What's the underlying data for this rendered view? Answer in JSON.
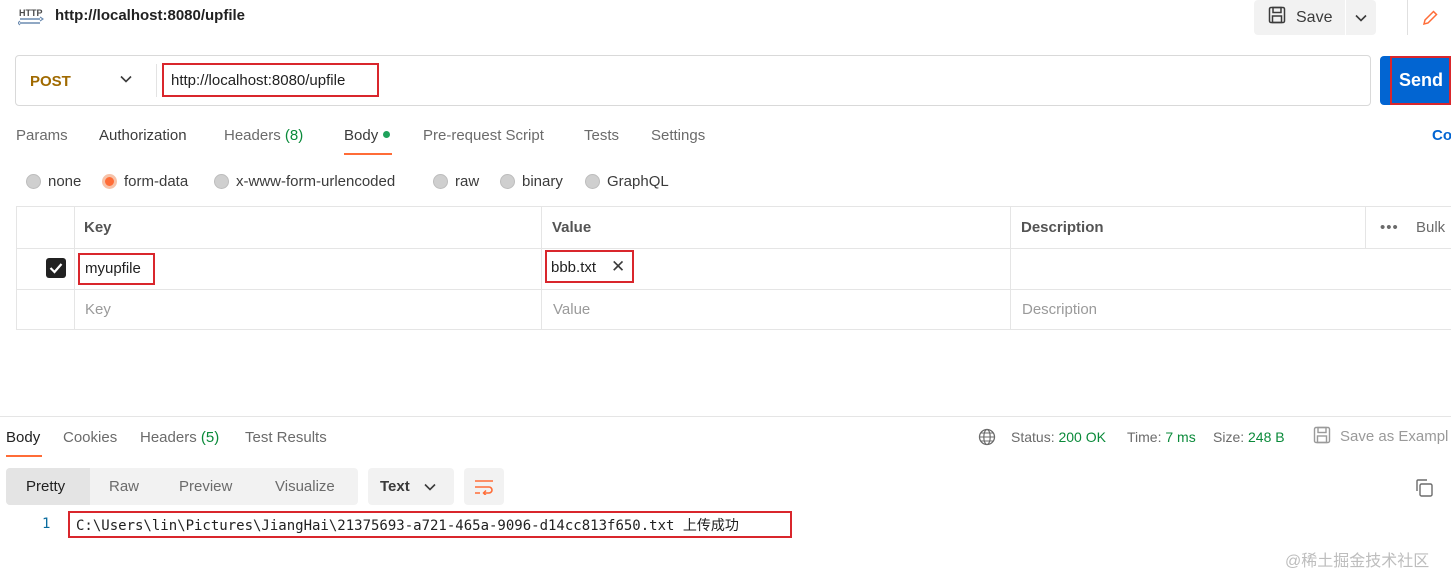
{
  "title_bar": {
    "http_icon_label": "HTTP",
    "request_title": "http://localhost:8080/upfile",
    "save_label": "Save"
  },
  "request": {
    "method": "POST",
    "url": "http://localhost:8080/upfile",
    "send_label": "Send",
    "tabs": [
      {
        "label": "Params"
      },
      {
        "label": "Authorization"
      },
      {
        "label": "Headers",
        "count": "(8)"
      },
      {
        "label": "Body"
      },
      {
        "label": "Pre-request Script"
      },
      {
        "label": "Tests"
      },
      {
        "label": "Settings"
      }
    ],
    "cookies_label": "Co",
    "body_types": [
      "none",
      "form-data",
      "x-www-form-urlencoded",
      "raw",
      "binary",
      "GraphQL"
    ],
    "selected_body_type": "form-data"
  },
  "form_table": {
    "headers": {
      "key": "Key",
      "value": "Value",
      "description": "Description",
      "bulk": "Bulk"
    },
    "rows": [
      {
        "checked": true,
        "key": "myupfile",
        "value": "bbb.txt",
        "description": ""
      }
    ],
    "placeholders": {
      "key": "Key",
      "value": "Value",
      "description": "Description"
    }
  },
  "response": {
    "tabs": [
      {
        "label": "Body"
      },
      {
        "label": "Cookies"
      },
      {
        "label": "Headers",
        "count": "(5)"
      },
      {
        "label": "Test Results"
      }
    ],
    "status_label": "Status:",
    "status_value": "200 OK",
    "time_label": "Time:",
    "time_value": "7 ms",
    "size_label": "Size:",
    "size_value": "248 B",
    "save_example_label": "Save as Exampl",
    "view_modes": [
      "Pretty",
      "Raw",
      "Preview",
      "Visualize"
    ],
    "format": "Text",
    "line_number": "1",
    "body_line": "C:\\Users\\lin\\Pictures\\JiangHai\\21375693-a721-465a-9096-d14cc813f650.txt 上传成功"
  },
  "watermark": "@稀土掘金技术社区",
  "colors": {
    "send": "#0265d2",
    "accent": "#ff6c37",
    "success": "#0a8a3a",
    "method": "#a06a00",
    "highlight_box": "#d9262c"
  }
}
